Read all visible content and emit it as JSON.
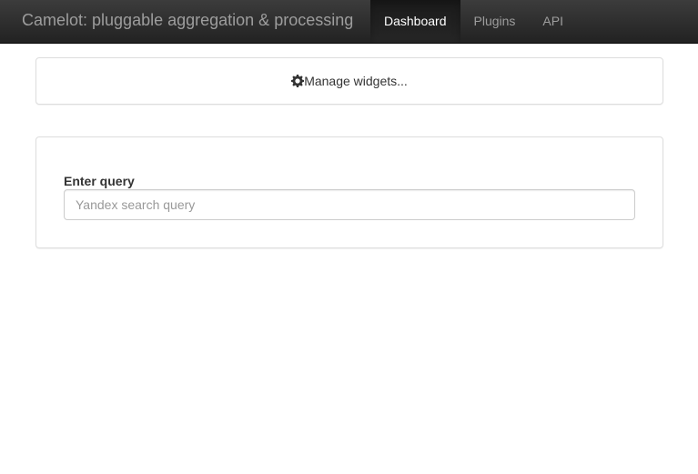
{
  "navbar": {
    "brand": "Camelot: pluggable aggregation & processing",
    "items": [
      {
        "label": "Dashboard",
        "active": true
      },
      {
        "label": "Plugins",
        "active": false
      },
      {
        "label": "API",
        "active": false
      }
    ]
  },
  "manage": {
    "label": "Manage widgets...",
    "icon": "gear-icon"
  },
  "query": {
    "label": "Enter query",
    "placeholder": "Yandex search query",
    "value": ""
  },
  "colors": {
    "navbar_bg": "#222222",
    "navbar_text": "#9d9d9d",
    "active_text": "#ffffff",
    "panel_border": "#dddddd"
  }
}
